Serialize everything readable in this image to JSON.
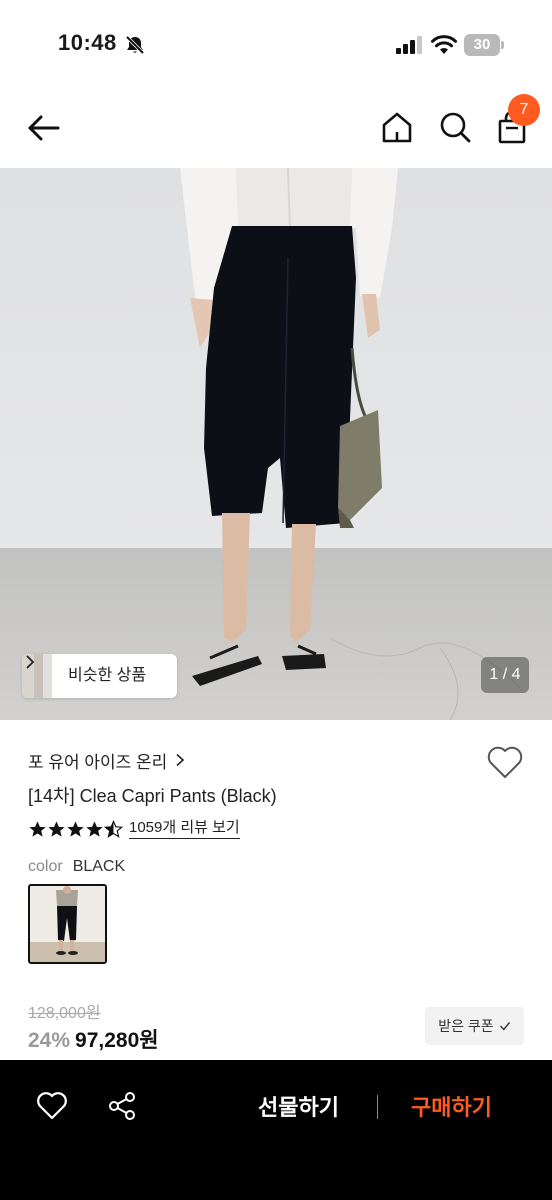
{
  "status_bar": {
    "time": "10:48",
    "battery": "30"
  },
  "nav": {
    "cart_count": "7"
  },
  "image": {
    "similar_label": "비슷한 상품",
    "page_indicator": "1 / 4"
  },
  "product": {
    "brand": "포 유어 아이즈 온리",
    "title": "[14차] Clea Capri Pants (Black)",
    "rating": 4.5,
    "review_link": "1059개 리뷰 보기",
    "color_label": "color",
    "color_value": "BLACK",
    "original_price": "128,000원",
    "discount": "24%",
    "sale_price": "97,280원",
    "coupon_label": "받은 쿠폰"
  },
  "bottom_bar": {
    "gift_label": "선물하기",
    "buy_label": "구매하기"
  },
  "colors": {
    "accent": "#ff5a1f",
    "bottom_bar": "#000000"
  }
}
